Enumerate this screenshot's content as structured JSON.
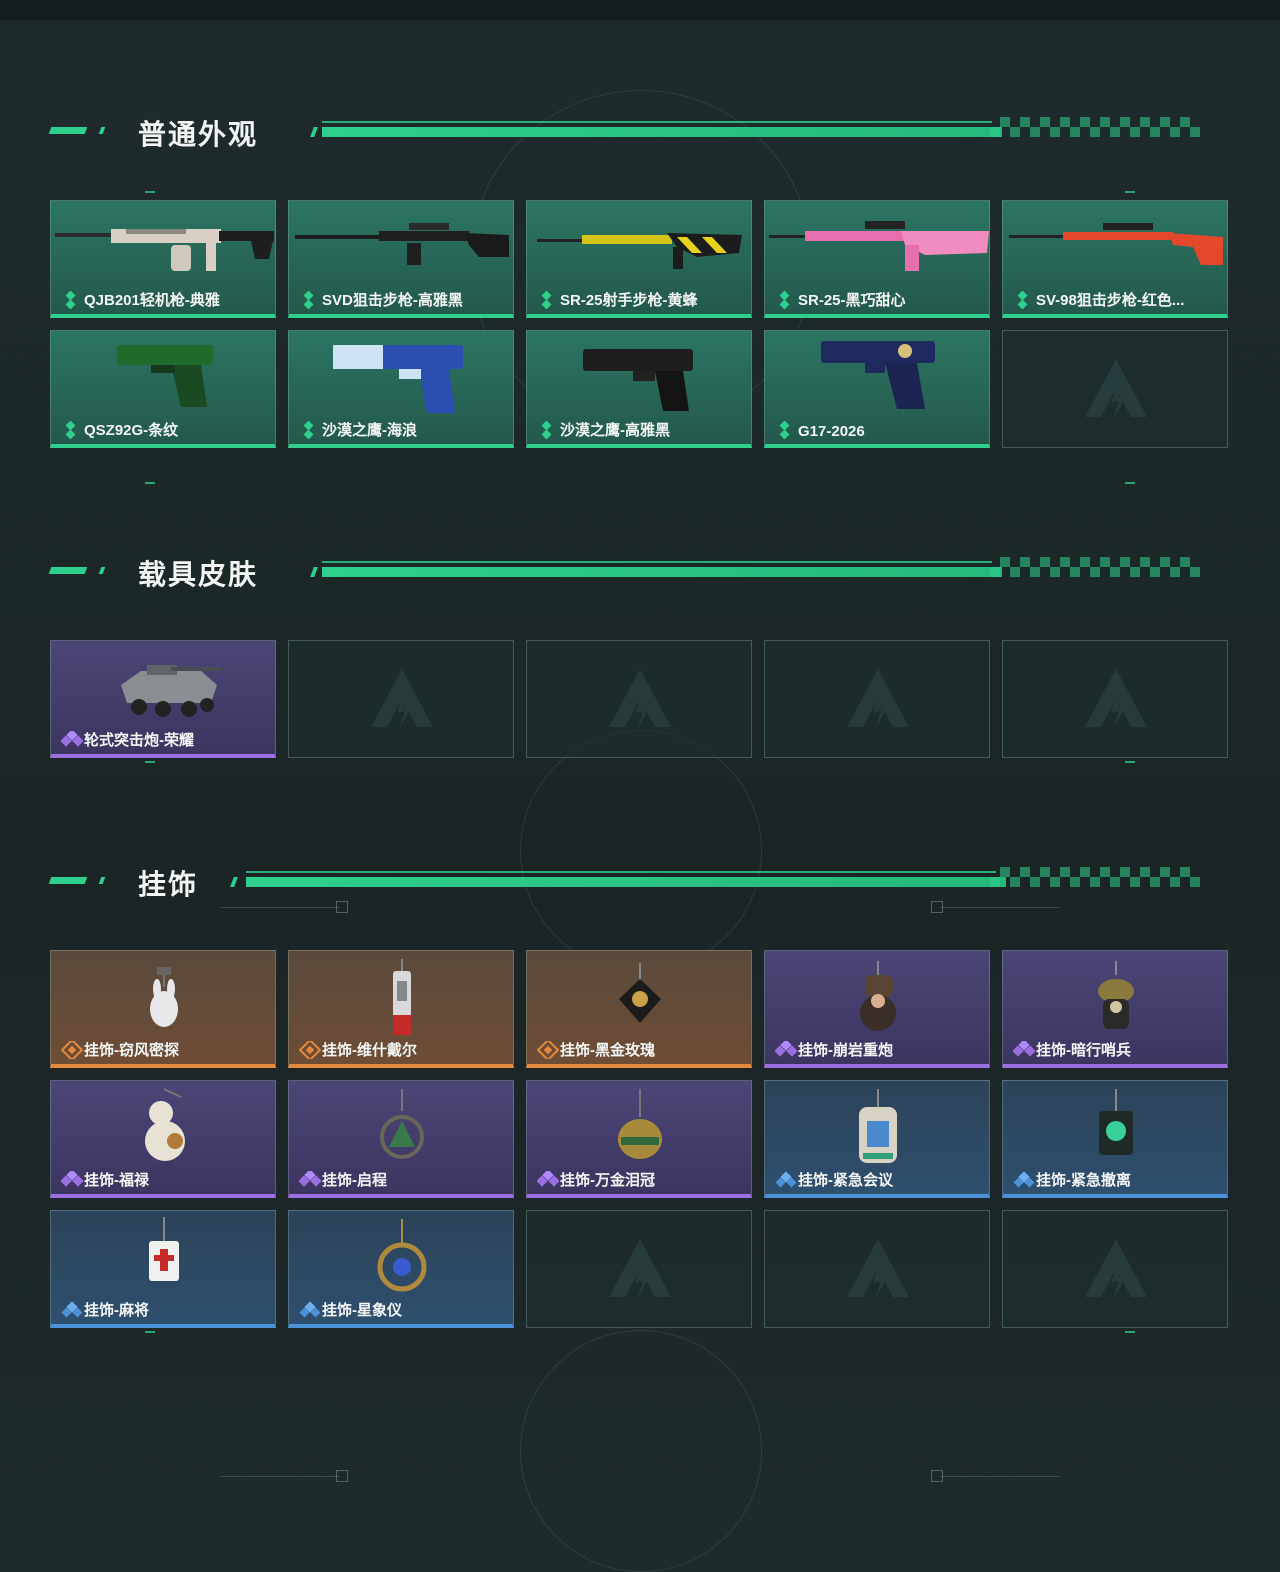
{
  "sections": [
    {
      "title": "普通外观",
      "items": [
        {
          "label": "QJB201轻机枪-典雅",
          "rarity": "green",
          "icon": "machine-gun-icon"
        },
        {
          "label": "SVD狙击步枪-高雅黑",
          "rarity": "green",
          "icon": "sniper-rifle-icon"
        },
        {
          "label": "SR-25射手步枪-黄蜂",
          "rarity": "green",
          "icon": "marksman-rifle-icon"
        },
        {
          "label": "SR-25-黑巧甜心",
          "rarity": "green",
          "icon": "marksman-rifle-icon"
        },
        {
          "label": "SV-98狙击步枪-红色...",
          "rarity": "green",
          "icon": "sniper-rifle-icon"
        },
        {
          "label": "QSZ92G-条纹",
          "rarity": "green",
          "icon": "pistol-icon"
        },
        {
          "label": "沙漠之鹰-海浪",
          "rarity": "green",
          "icon": "pistol-icon"
        },
        {
          "label": "沙漠之鹰-高雅黑",
          "rarity": "green",
          "icon": "pistol-icon"
        },
        {
          "label": "G17-2026",
          "rarity": "green",
          "icon": "pistol-icon"
        }
      ]
    },
    {
      "title": "载具皮肤",
      "items": [
        {
          "label": "轮式突击炮-荣耀",
          "rarity": "purple",
          "icon": "armored-vehicle-icon"
        }
      ]
    },
    {
      "title": "挂饰",
      "items": [
        {
          "label": "挂饰-窃风密探",
          "rarity": "orange",
          "icon": "rabbit-charm-icon"
        },
        {
          "label": "挂饰-维什戴尔",
          "rarity": "orange",
          "icon": "tag-charm-icon"
        },
        {
          "label": "挂饰-黑金玫瑰",
          "rarity": "orange",
          "icon": "rose-charm-icon"
        },
        {
          "label": "挂饰-崩岩重炮",
          "rarity": "purple",
          "icon": "figure-charm-icon"
        },
        {
          "label": "挂饰-暗行哨兵",
          "rarity": "purple",
          "icon": "sentry-charm-icon"
        },
        {
          "label": "挂饰-福禄",
          "rarity": "purple",
          "icon": "gourd-charm-icon"
        },
        {
          "label": "挂饰-启程",
          "rarity": "purple",
          "icon": "emblem-charm-icon"
        },
        {
          "label": "挂饰-万金泪冠",
          "rarity": "purple",
          "icon": "crown-charm-icon"
        },
        {
          "label": "挂饰-紧急会议",
          "rarity": "blue",
          "icon": "badge-charm-icon"
        },
        {
          "label": "挂饰-紧急撤离",
          "rarity": "blue",
          "icon": "skull-charm-icon"
        },
        {
          "label": "挂饰-麻将",
          "rarity": "blue",
          "icon": "mahjong-charm-icon"
        },
        {
          "label": "挂饰-星象仪",
          "rarity": "blue",
          "icon": "astrolabe-charm-icon"
        }
      ]
    }
  ],
  "colors": {
    "accent": "#2fd08d",
    "green": "#2fd08d",
    "purple": "#9b6fe0",
    "orange": "#e58a3c",
    "blue": "#4c92d8"
  }
}
